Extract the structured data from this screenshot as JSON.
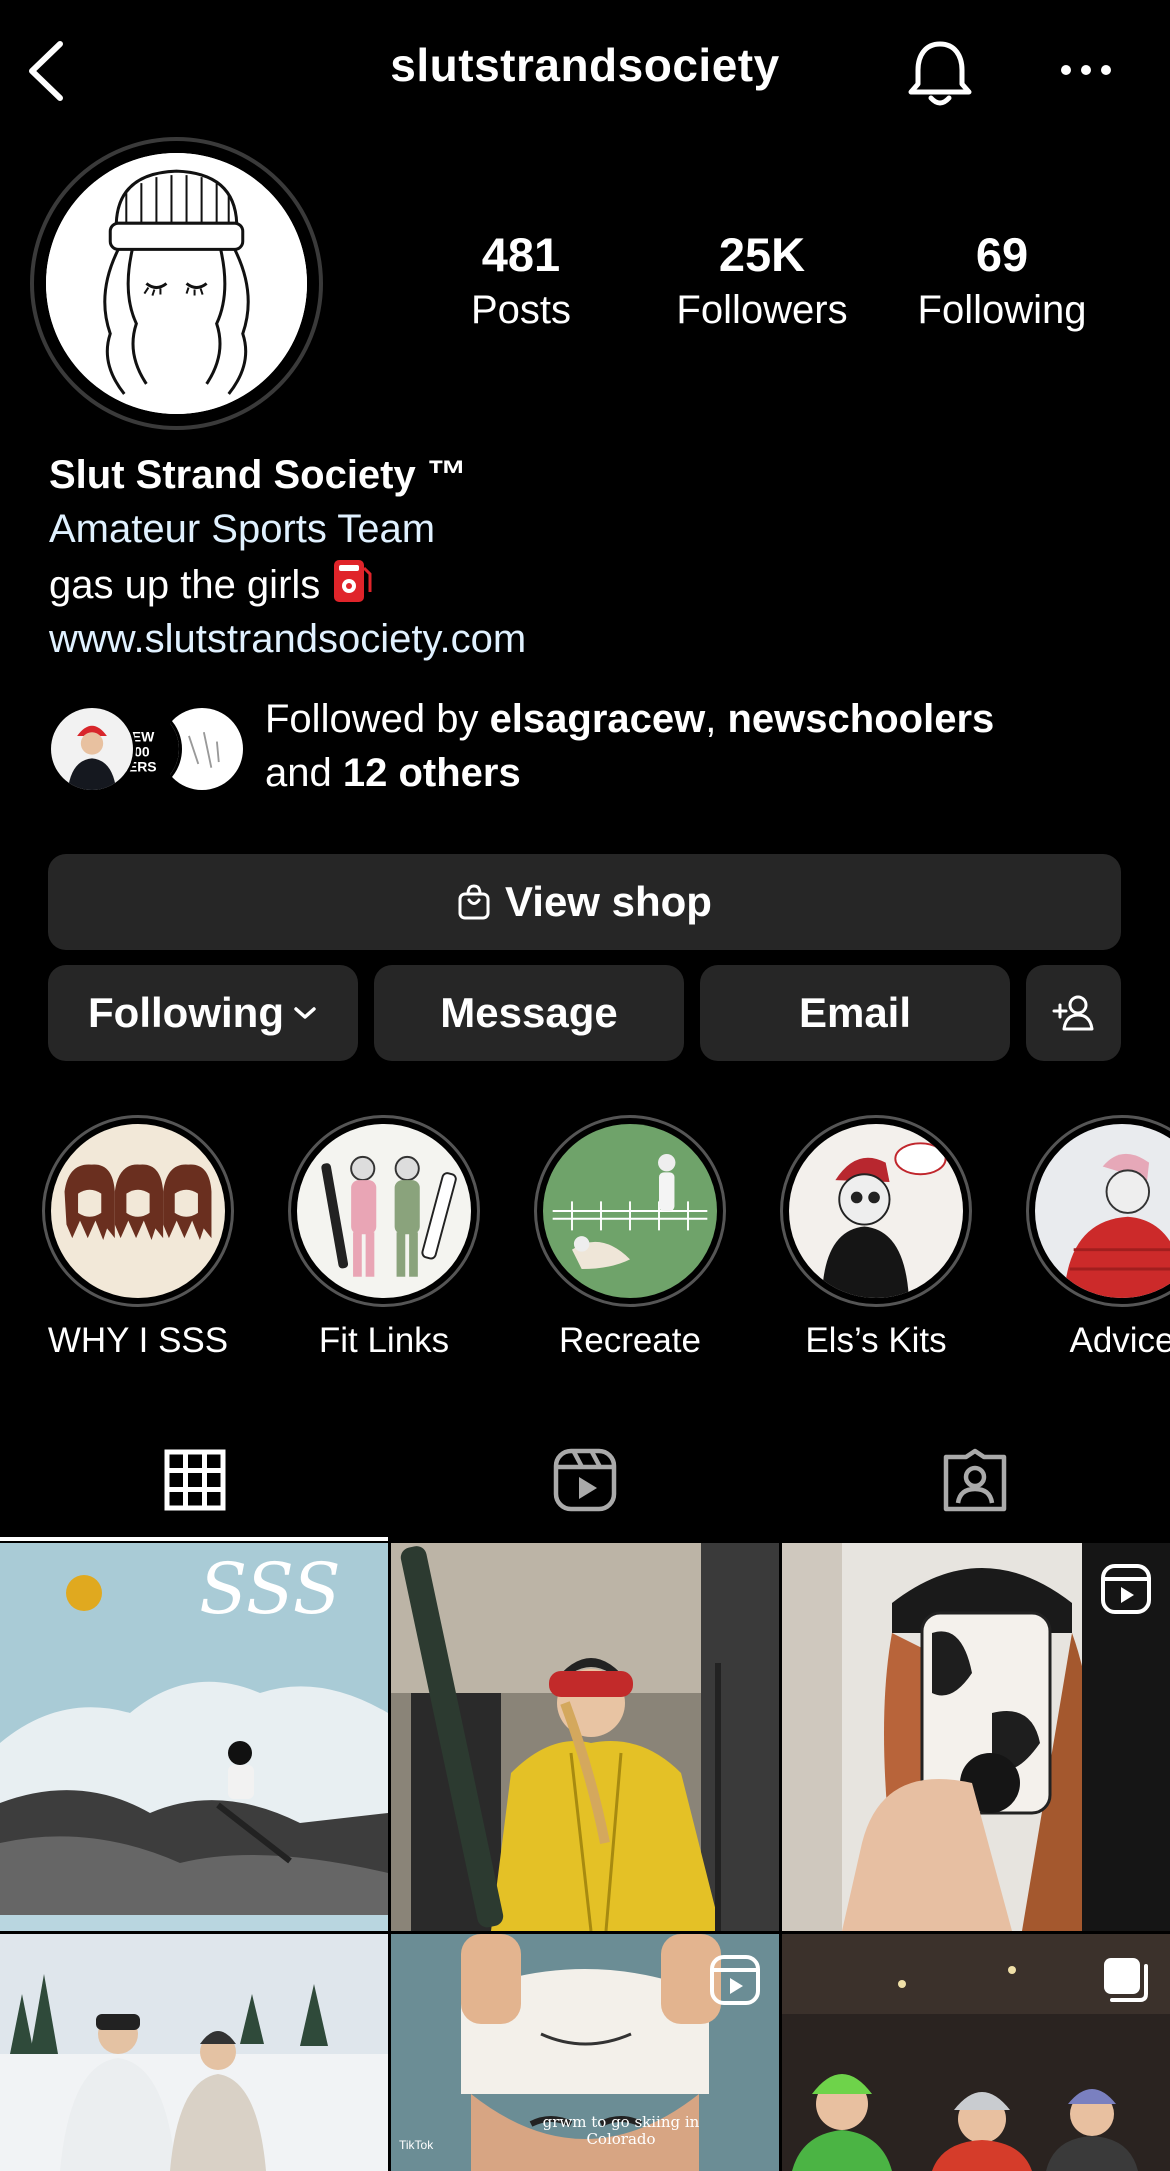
{
  "header": {
    "username": "slutstrandsociety",
    "icons": {
      "back": "chevron-left-icon",
      "bell": "bell-icon",
      "more": "more-horizontal-icon"
    }
  },
  "stats": [
    {
      "value": "481",
      "label": "Posts"
    },
    {
      "value": "25K",
      "label": "Followers"
    },
    {
      "value": "69",
      "label": "Following"
    }
  ],
  "bio": {
    "name": "Slut Strand Society ™",
    "category": "Amateur Sports Team",
    "line": "gas up the girls",
    "link": "www.slutstrandsociety.com"
  },
  "followed_by": {
    "prefix": "Followed by ",
    "user1": "elsagracew",
    "sep": ", ",
    "user2": "newschoolers",
    "and": "and ",
    "others": "12 others"
  },
  "buttons": {
    "shop": "View shop",
    "following": "Following",
    "message": "Message",
    "email": "Email"
  },
  "highlights": [
    {
      "label": "WHY I SSS"
    },
    {
      "label": "Fit Links"
    },
    {
      "label": "Recreate"
    },
    {
      "label": "Els’s Kits"
    },
    {
      "label": "Advice"
    }
  ],
  "grid_overlays": {
    "post3": "reel-icon",
    "post5": "reel-icon",
    "post6": "carousel-icon",
    "post5_caption": "grwm to go skiing in Colorado",
    "post5_watermark": "TikTok"
  },
  "colors": {
    "background": "#000000",
    "button": "#262626",
    "link": "#e0f1ff"
  }
}
